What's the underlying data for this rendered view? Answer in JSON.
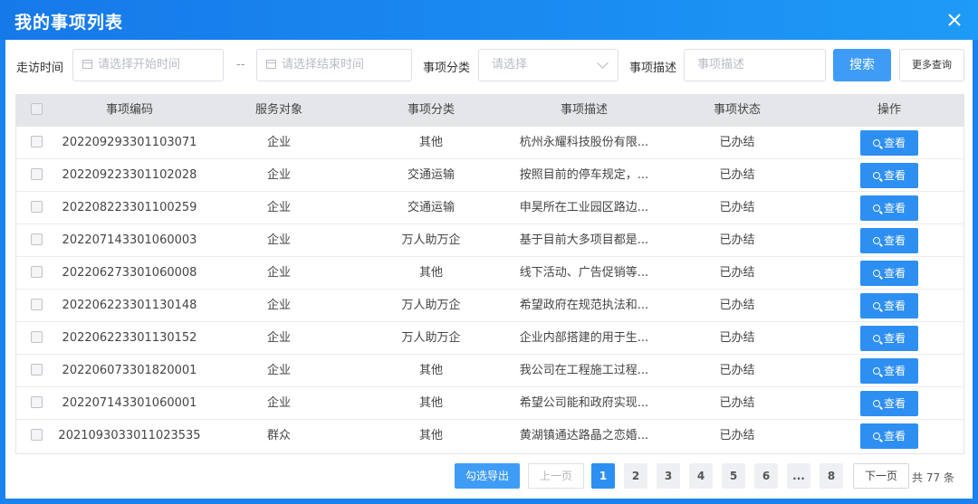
{
  "window": {
    "title": "我的事项列表"
  },
  "filters": {
    "visit_time_label": "走访时间",
    "start_placeholder": "请选择开始时间",
    "range_separator": "--",
    "end_placeholder": "请选择结束时间",
    "category_label": "事项分类",
    "category_placeholder": "请选择",
    "desc_label": "事项描述",
    "desc_placeholder": "事项描述",
    "search_label": "搜索",
    "more_label": "更多查询"
  },
  "table": {
    "columns": [
      "事项编码",
      "服务对象",
      "事项分类",
      "事项描述",
      "事项状态",
      "操作"
    ],
    "view_label": "查看",
    "rows": [
      {
        "code": "202209293301103071",
        "target": "企业",
        "category": "其他",
        "desc": "杭州永耀科技股份有限...",
        "status": "已办结"
      },
      {
        "code": "202209223301102028",
        "target": "企业",
        "category": "交通运输",
        "desc": "按照目前的停车规定，...",
        "status": "已办结"
      },
      {
        "code": "202208223301100259",
        "target": "企业",
        "category": "交通运输",
        "desc": "申昊所在工业园区路边...",
        "status": "已办结"
      },
      {
        "code": "202207143301060003",
        "target": "企业",
        "category": "万人助万企",
        "desc": "基于目前大多项目都是...",
        "status": "已办结"
      },
      {
        "code": "202206273301060008",
        "target": "企业",
        "category": "其他",
        "desc": "线下活动、广告促销等...",
        "status": "已办结"
      },
      {
        "code": "202206223301130148",
        "target": "企业",
        "category": "万人助万企",
        "desc": "希望政府在规范执法和...",
        "status": "已办结"
      },
      {
        "code": "202206223301130152",
        "target": "企业",
        "category": "万人助万企",
        "desc": "企业内部搭建的用于生...",
        "status": "已办结"
      },
      {
        "code": "202206073301820001",
        "target": "企业",
        "category": "其他",
        "desc": "我公司在工程施工过程...",
        "status": "已办结"
      },
      {
        "code": "202207143301060001",
        "target": "企业",
        "category": "其他",
        "desc": "希望公司能和政府实现...",
        "status": "已办结"
      },
      {
        "code": "2021093033011023535",
        "target": "群众",
        "category": "其他",
        "desc": "黄湖镇通达路晶之恋婚...",
        "status": "已办结"
      }
    ]
  },
  "pagination": {
    "export_label": "勾选导出",
    "prev_label": "上一页",
    "pages": [
      "1",
      "2",
      "3",
      "4",
      "5",
      "6",
      "...",
      "8"
    ],
    "current_page": "1",
    "next_label": "下一页",
    "total_text": "共 77 条"
  }
}
